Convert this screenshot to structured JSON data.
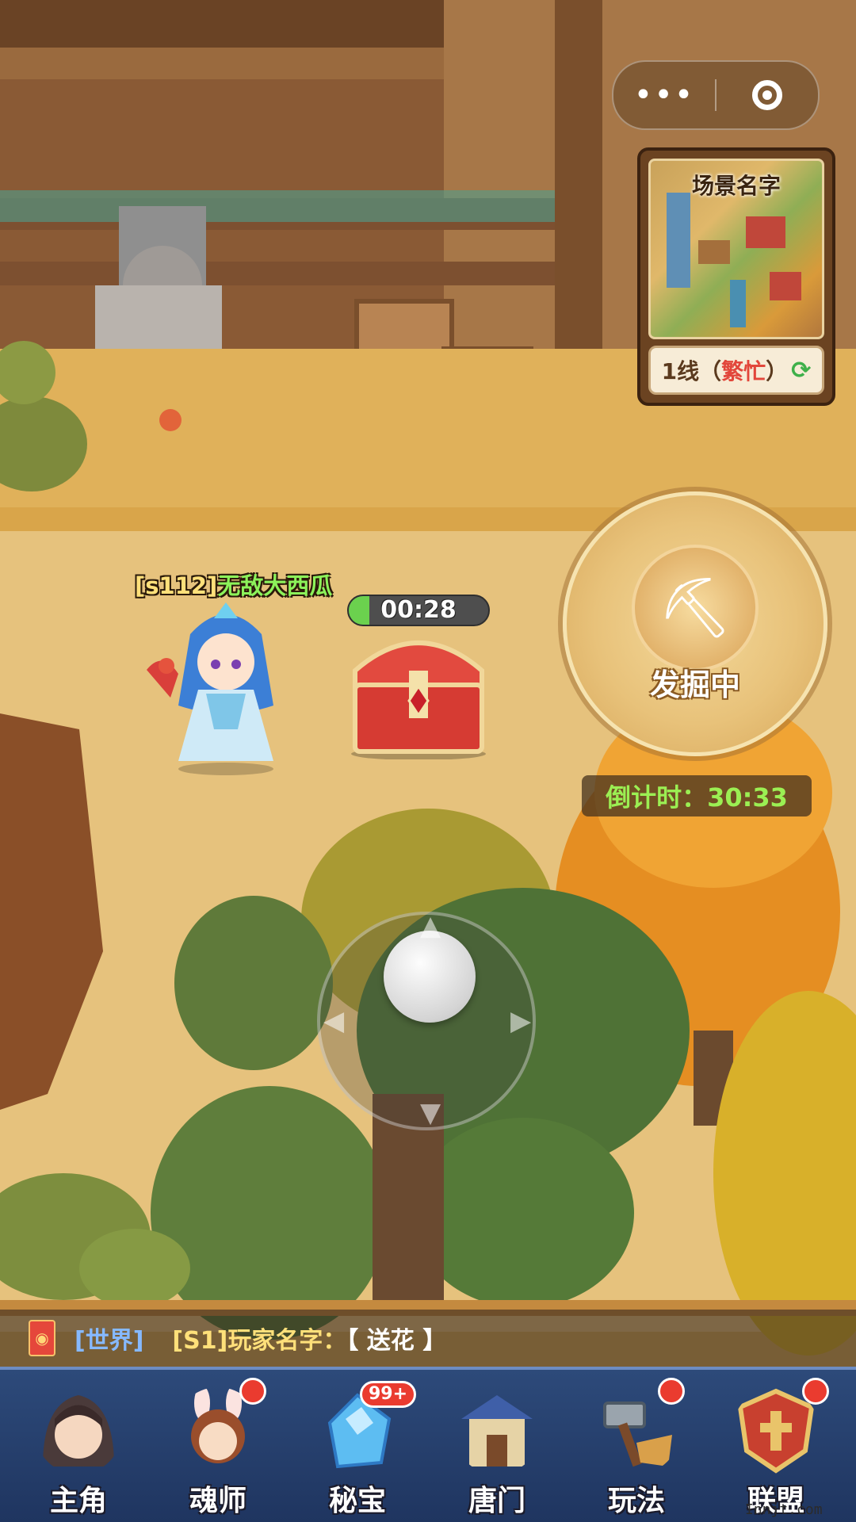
{
  "minimap": {
    "title": "场景名字",
    "line_prefix": "1线（",
    "line_status": "繁忙",
    "line_suffix": "）",
    "refresh_icon": "refresh-icon"
  },
  "capsule": {
    "more_icon": "more-dots-icon",
    "close_icon": "target-circle-icon"
  },
  "dig_button": {
    "label": "发掘中",
    "icon": "shovel-icon"
  },
  "countdown": {
    "text": "倒计时：30:33"
  },
  "player": {
    "server_tag": "[s112]",
    "name": "无敌大西瓜"
  },
  "chest": {
    "timer": "00:28",
    "progress_percent": 15
  },
  "joystick": {
    "icon": "joystick"
  },
  "chat": {
    "channel": "[世界]",
    "sender": "[S1]玩家名字：",
    "content": "【 送花 】",
    "icon": "red-packet-icon"
  },
  "nav": [
    {
      "label": "主角",
      "icon": "hero-portrait-icon",
      "dot": false,
      "badge": ""
    },
    {
      "label": "魂师",
      "icon": "soul-master-icon",
      "dot": true,
      "badge": ""
    },
    {
      "label": "秘宝",
      "icon": "crystal-treasure-icon",
      "dot": false,
      "badge": "99+"
    },
    {
      "label": "唐门",
      "icon": "tang-sect-gate-icon",
      "dot": false,
      "badge": ""
    },
    {
      "label": "玩法",
      "icon": "hammer-gameplay-icon",
      "dot": true,
      "badge": ""
    },
    {
      "label": "联盟",
      "icon": "alliance-shield-icon",
      "dot": true,
      "badge": ""
    }
  ],
  "watermark": "Innjt.com"
}
